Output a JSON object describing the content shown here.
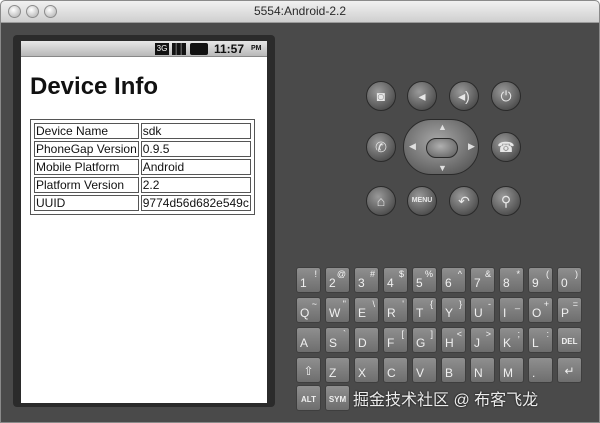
{
  "window": {
    "title": "5554:Android-2.2"
  },
  "status_bar": {
    "icons": [
      "3G-icon",
      "signal-icon",
      "battery-icon"
    ],
    "time": "11:57",
    "ampm": "PM"
  },
  "page": {
    "title": "Device Info",
    "rows": [
      {
        "label": "Device Name",
        "value": "sdk"
      },
      {
        "label": "PhoneGap Version",
        "value": "0.9.5"
      },
      {
        "label": "Mobile Platform",
        "value": "Android"
      },
      {
        "label": "Platform Version",
        "value": "2.2"
      },
      {
        "label": "UUID",
        "value": "9774d56d682e549c"
      }
    ]
  },
  "controls": {
    "menu_label": "MENU"
  },
  "keyboard": {
    "row1": [
      {
        "main": "1",
        "alt": "!"
      },
      {
        "main": "2",
        "alt": "@"
      },
      {
        "main": "3",
        "alt": "#"
      },
      {
        "main": "4",
        "alt": "$"
      },
      {
        "main": "5",
        "alt": "%"
      },
      {
        "main": "6",
        "alt": "^"
      },
      {
        "main": "7",
        "alt": "&"
      },
      {
        "main": "8",
        "alt": "*"
      },
      {
        "main": "9",
        "alt": "("
      },
      {
        "main": "0",
        "alt": ")"
      }
    ],
    "row2": [
      {
        "main": "Q",
        "alt": "~"
      },
      {
        "main": "W",
        "alt": "\""
      },
      {
        "main": "E",
        "alt": "\\"
      },
      {
        "main": "R",
        "alt": "'"
      },
      {
        "main": "T",
        "alt": "{"
      },
      {
        "main": "Y",
        "alt": "}"
      },
      {
        "main": "U",
        "alt": "-"
      },
      {
        "main": "I",
        "alt": "_"
      },
      {
        "main": "O",
        "alt": "+"
      },
      {
        "main": "P",
        "alt": "="
      }
    ],
    "row3": [
      {
        "main": "A",
        "alt": ""
      },
      {
        "main": "S",
        "alt": "`"
      },
      {
        "main": "D",
        "alt": ""
      },
      {
        "main": "F",
        "alt": "["
      },
      {
        "main": "G",
        "alt": "]"
      },
      {
        "main": "H",
        "alt": "<"
      },
      {
        "main": "J",
        "alt": ">"
      },
      {
        "main": "K",
        "alt": ";"
      },
      {
        "main": "L",
        "alt": ":"
      }
    ],
    "del_label": "DEL",
    "row4": [
      {
        "main": "Z",
        "alt": ""
      },
      {
        "main": "X",
        "alt": ""
      },
      {
        "main": "C",
        "alt": ""
      },
      {
        "main": "V",
        "alt": ""
      },
      {
        "main": "B",
        "alt": ""
      },
      {
        "main": "N",
        "alt": ""
      },
      {
        "main": "M",
        "alt": ""
      },
      {
        "main": ".",
        "alt": ""
      }
    ],
    "alt_label": "ALT",
    "sym_label": "SYM"
  },
  "watermark": "掘金技术社区 @ 布客飞龙"
}
